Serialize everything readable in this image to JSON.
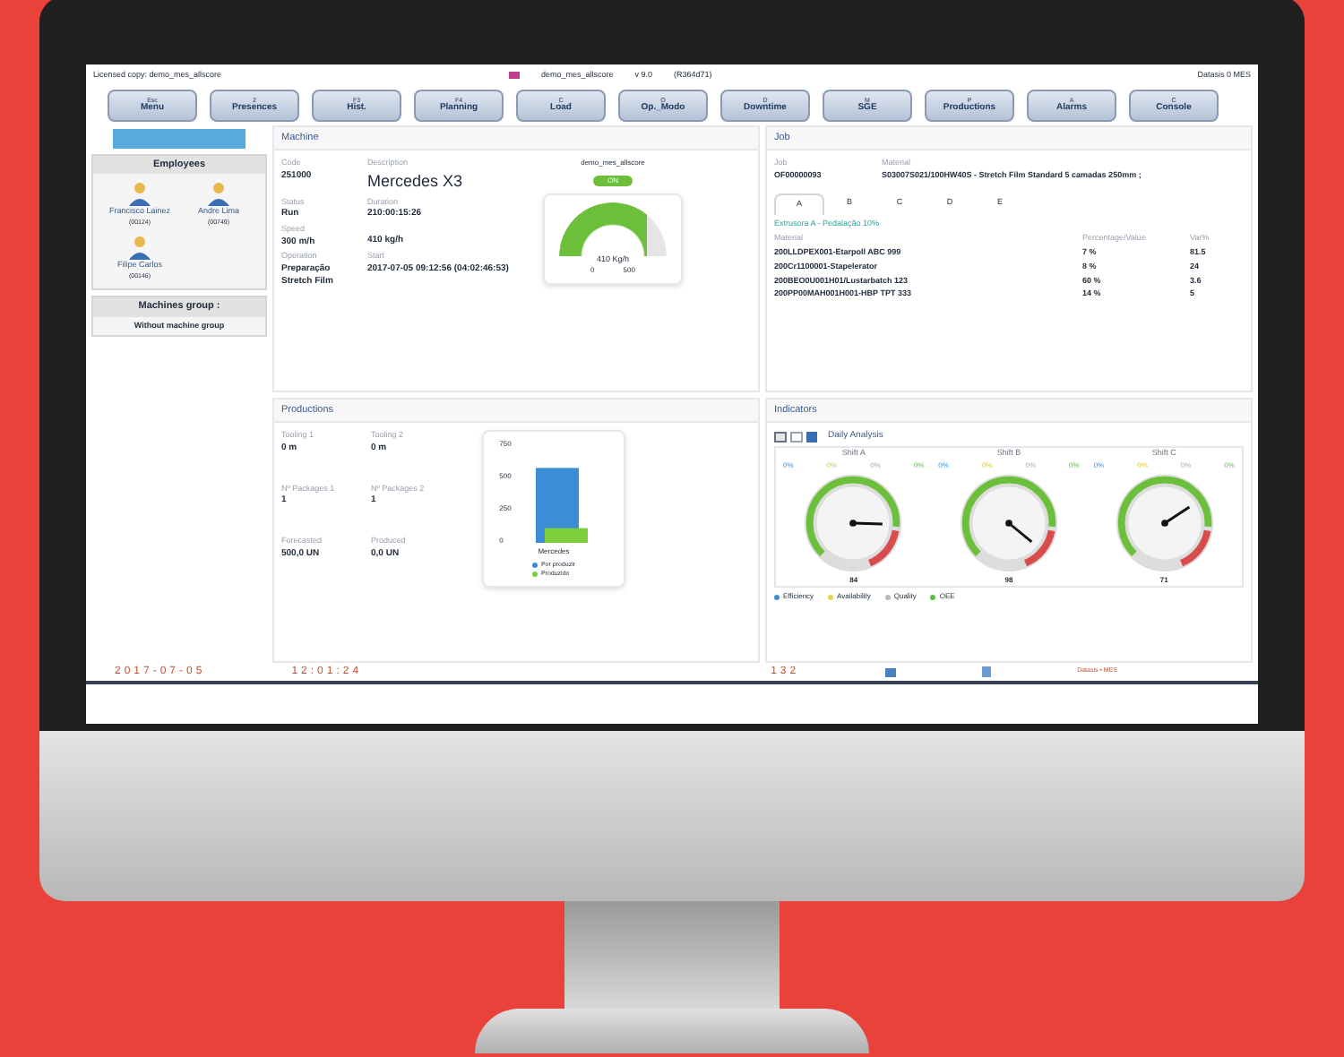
{
  "header": {
    "license": "Licensed copy: demo_mes_allscore",
    "user": "demo_mes_allscore",
    "version": "v 9.0",
    "build": "(R364d71)",
    "brand": "Datasis 0 MES"
  },
  "toolbar": [
    {
      "key": "Esc",
      "label": "Menu"
    },
    {
      "key": "2",
      "label": "Presences"
    },
    {
      "key": "F3",
      "label": "Hist."
    },
    {
      "key": "F4",
      "label": "Planning"
    },
    {
      "key": "C",
      "label": "Load"
    },
    {
      "key": "O",
      "label": "Op._Modo"
    },
    {
      "key": "D",
      "label": "Downtime"
    },
    {
      "key": "M",
      "label": "SGE"
    },
    {
      "key": "P",
      "label": "Productions"
    },
    {
      "key": "A",
      "label": "Alarms"
    },
    {
      "key": "C",
      "label": "Console"
    }
  ],
  "sidebar": {
    "employees_title": "Employees",
    "employees": [
      {
        "name": "Francisco Lainez",
        "id": "(00124)"
      },
      {
        "name": "Andre Lima",
        "id": "(00749)"
      },
      {
        "name": "Filipe Carlos",
        "id": "(00146)"
      }
    ],
    "group_title": "Machines group :",
    "group": "Without machine group"
  },
  "machine": {
    "title": "Machine",
    "fields": [
      {
        "label": "Code",
        "value": "251000"
      },
      {
        "label": "Description",
        "value": "Mercedes X3"
      },
      {
        "label": "Status",
        "value": "Run"
      },
      {
        "label": "Duration",
        "value": "210:00:15:26"
      },
      {
        "label": "Speed",
        "value": "300 m/h"
      },
      {
        "value": "410 kg/h"
      },
      {
        "label": "Operation",
        "value": "Preparação Stretch Film"
      },
      {
        "label": "Start",
        "value": "2017-07-05 09:12:56  (04:02:46:53)"
      }
    ],
    "user": "demo_mes_allscore",
    "state": "ON",
    "gauge": {
      "reading": "410",
      "unit": "Kg/h",
      "min": "0",
      "max": "500",
      "level": 0.82
    }
  },
  "job": {
    "title": "Job",
    "job_label": "Job",
    "job": "OF00000093",
    "material_label": "Material",
    "material": "S03007S021/100HW40S - Stretch Film Standard 5 camadas 250mm ;",
    "tabs": [
      {
        "label": "A",
        "selected": true
      },
      {
        "label": "B",
        "selected": false
      },
      {
        "label": "C",
        "selected": false
      },
      {
        "label": "D",
        "selected": false
      },
      {
        "label": "E",
        "selected": false
      }
    ],
    "subtitle": "Extrusora A - Pedalação 10%",
    "columns": [
      "Material",
      "Percentage/Value",
      "Var%"
    ],
    "rows": [
      [
        "200LLDPEX001-Etarpoll ABC 999",
        "7 %",
        "81.5"
      ],
      [
        "200Cr1100001-Stapelerator",
        "8 %",
        "24"
      ],
      [
        "200BEO0U001H01/Lustarbatch 123",
        "60 %",
        "3.6"
      ],
      [
        "200PP00MAH001H001-HBP TPT 333",
        "14 %",
        "5"
      ]
    ]
  },
  "productions": {
    "title": "Productions",
    "fields": [
      {
        "label": "Tooling 1",
        "value": "0 m"
      },
      {
        "label": "Tooling 2",
        "value": "0 m"
      },
      {
        "label": "Nº Packages 1",
        "value": "1"
      },
      {
        "label": "Nº Packages 2",
        "value": "1"
      },
      {
        "label": "Forecasted",
        "value": "500,0 UN"
      },
      {
        "label": "Produced",
        "value": "0,0 UN"
      }
    ],
    "chart_data": {
      "type": "bar",
      "categories": [
        "Mercedes"
      ],
      "yticks": [
        0,
        250,
        500,
        750
      ],
      "ylim": [
        0,
        750
      ],
      "legend": "bottom",
      "series": [
        {
          "name": "Por produzir",
          "color": "#3b8ed6",
          "values": [
            560
          ]
        },
        {
          "name": "Produzido",
          "color": "#7ccf3a",
          "values": [
            110
          ]
        }
      ]
    }
  },
  "indicators": {
    "title": "Indicators",
    "view": "Daily Analysis",
    "shifts": [
      {
        "name": "Shift A",
        "pcts": [
          "0%",
          "0%",
          "0%",
          "0%"
        ],
        "reading": "84"
      },
      {
        "name": "Shift B",
        "pcts": [
          "0%",
          "0%",
          "0%",
          "0%"
        ],
        "reading": "98"
      },
      {
        "name": "Shift C",
        "pcts": [
          "0%",
          "0%",
          "0%",
          "0%"
        ],
        "reading": "71"
      }
    ],
    "legend": [
      {
        "label": "Efficiency",
        "color": "#3b8ed6"
      },
      {
        "label": "Availability",
        "color": "#e8d84a"
      },
      {
        "label": "Quality",
        "color": "#bbbbbb"
      },
      {
        "label": "OEE",
        "color": "#5cbd4a"
      }
    ]
  },
  "status_bar": {
    "date": "2017-07-05",
    "time": "12:01:24",
    "count": "132",
    "link": "Datasis • MES"
  }
}
